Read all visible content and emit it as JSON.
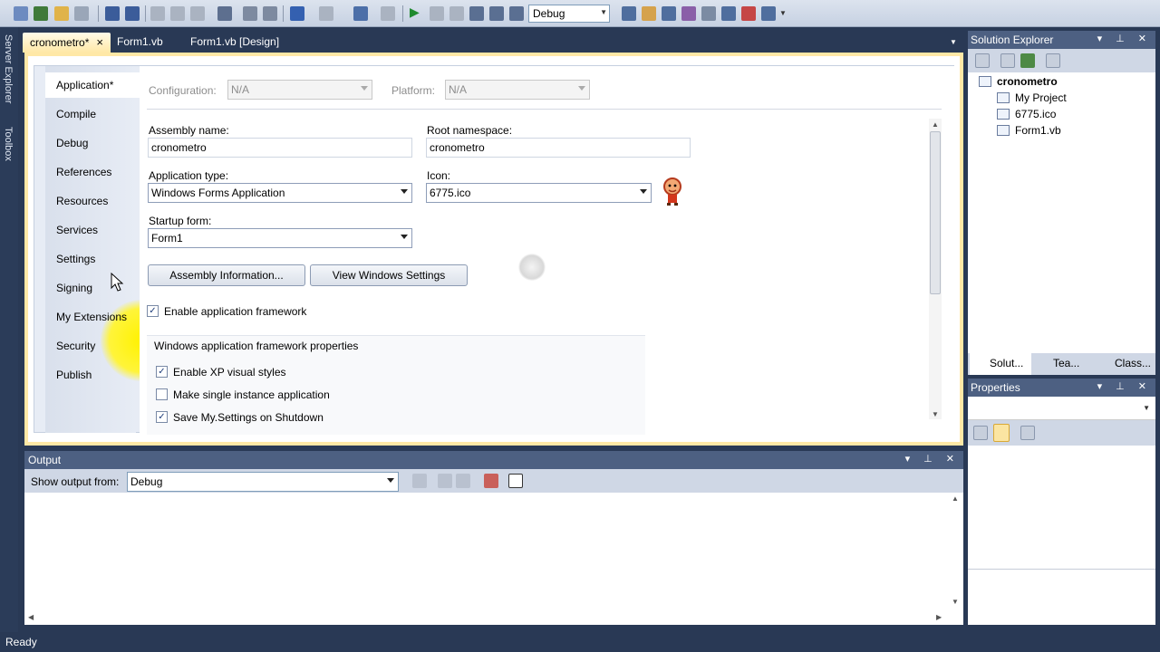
{
  "toolbar": {
    "config_value": "Debug"
  },
  "side_strip": {
    "server_explorer": "Server Explorer",
    "toolbox": "Toolbox"
  },
  "doc_tabs": [
    {
      "label": "cronometro*",
      "close": "×",
      "active": true
    },
    {
      "label": "Form1.vb"
    },
    {
      "label": "Form1.vb [Design]"
    }
  ],
  "nav": [
    "Application*",
    "Compile",
    "Debug",
    "References",
    "Resources",
    "Services",
    "Settings",
    "Signing",
    "My Extensions",
    "Security",
    "Publish"
  ],
  "app": {
    "configuration_label": "Configuration:",
    "configuration_value": "N/A",
    "platform_label": "Platform:",
    "platform_value": "N/A",
    "assembly_name_label": "Assembly name:",
    "assembly_name_value": "cronometro",
    "root_namespace_label": "Root namespace:",
    "root_namespace_value": "cronometro",
    "app_type_label": "Application type:",
    "app_type_value": "Windows Forms Application",
    "icon_label": "Icon:",
    "icon_value": "6775.ico",
    "startup_label": "Startup form:",
    "startup_value": "Form1",
    "assembly_info_button": "Assembly Information...",
    "view_settings_button": "View Windows Settings",
    "enable_framework": "Enable application framework",
    "framework_props": "Windows application framework properties",
    "xp_styles": "Enable XP visual styles",
    "single_instance": "Make single instance application",
    "save_settings": "Save My.Settings on Shutdown"
  },
  "output": {
    "title": "Output",
    "show_from_label": "Show output from:",
    "show_from_value": "Debug"
  },
  "solution_explorer": {
    "title": "Solution Explorer",
    "items": [
      {
        "label": "cronometro",
        "bold": true
      },
      {
        "label": "My Project"
      },
      {
        "label": "6775.ico"
      },
      {
        "label": "Form1.vb"
      }
    ],
    "tabs": [
      "Solut...",
      "Tea...",
      "Class..."
    ]
  },
  "properties": {
    "title": "Properties"
  },
  "status": "Ready"
}
